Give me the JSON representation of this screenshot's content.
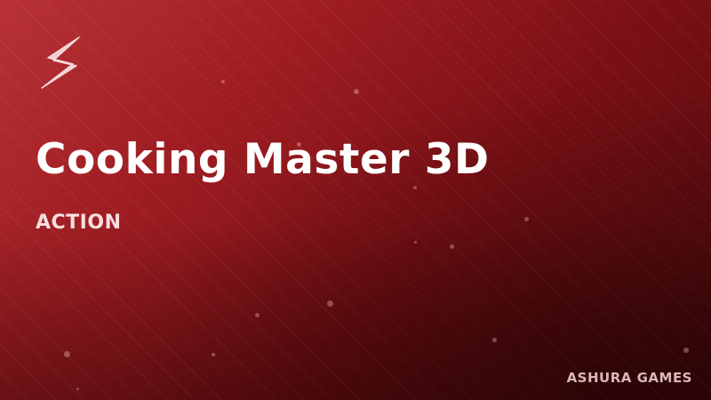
{
  "game": {
    "title": "Cooking Master 3D",
    "genre": "ACTION",
    "publisher": "ASHURA GAMES"
  },
  "logo": {
    "icon": "lightning-bolt-icon"
  },
  "colors": {
    "background_top": "#b83236",
    "background_bottom": "#4a0a0c",
    "title_text": "#ffffff",
    "genre_text": "#f6dede",
    "publisher_text": "#d9b7b7"
  }
}
